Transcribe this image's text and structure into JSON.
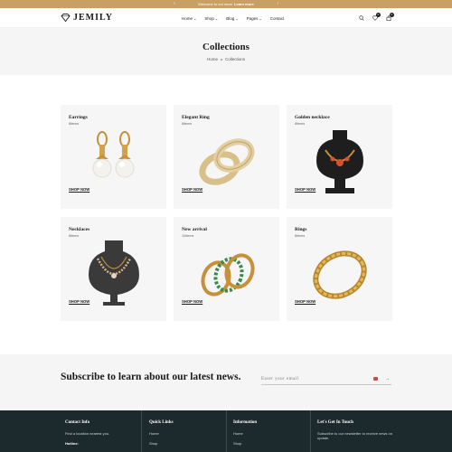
{
  "announcement": {
    "text": "Welcome to our store",
    "link": "Learn more"
  },
  "brand": "JEMILY",
  "nav": [
    {
      "label": "Home",
      "dropdown": true
    },
    {
      "label": "Shop",
      "dropdown": true
    },
    {
      "label": "Blog",
      "dropdown": true
    },
    {
      "label": "Pages",
      "dropdown": true
    },
    {
      "label": "Contact",
      "dropdown": false
    }
  ],
  "header_icons": {
    "wishlist_count": "0",
    "cart_count": "0"
  },
  "page": {
    "title": "Collections",
    "breadcrumb": [
      "Home",
      "Collections"
    ]
  },
  "collections": [
    {
      "title": "Earrings",
      "count": "8items",
      "cta": "SHOP NOW",
      "icon": "earrings"
    },
    {
      "title": "Elegant Ring",
      "count": "8items",
      "cta": "SHOP NOW",
      "icon": "rings-pair"
    },
    {
      "title": "Golden necklace",
      "count": "8items",
      "cta": "SHOP NOW",
      "icon": "necklace-bust"
    },
    {
      "title": "Necklaces",
      "count": "8items",
      "cta": "SHOP NOW",
      "icon": "pearl-necklace"
    },
    {
      "title": "New arrival",
      "count": "10items",
      "cta": "SHOP NOW",
      "icon": "bangles"
    },
    {
      "title": "Rings",
      "count": "8items",
      "cta": "SHOP NOW",
      "icon": "gold-bangle"
    }
  ],
  "newsletter": {
    "heading": "Subscribe to learn about our latest news.",
    "placeholder": "Enter your email"
  },
  "footer": {
    "contact": {
      "title": "Contact Info",
      "line1": "Find a location nearest you.",
      "line2": "Hotline:"
    },
    "quick_links": {
      "title": "Quick Links",
      "items": [
        "Home",
        "Shop"
      ]
    },
    "information": {
      "title": "Information",
      "items": [
        "Home",
        "Shop"
      ]
    },
    "touch": {
      "title": "Let's Get In Touch",
      "text": "Subscribe to our newsletter to receive news on update."
    }
  },
  "colors": {
    "accent": "#c8a064",
    "footer_bg": "#1d2a2d",
    "card_bg": "#f6f6f6"
  }
}
